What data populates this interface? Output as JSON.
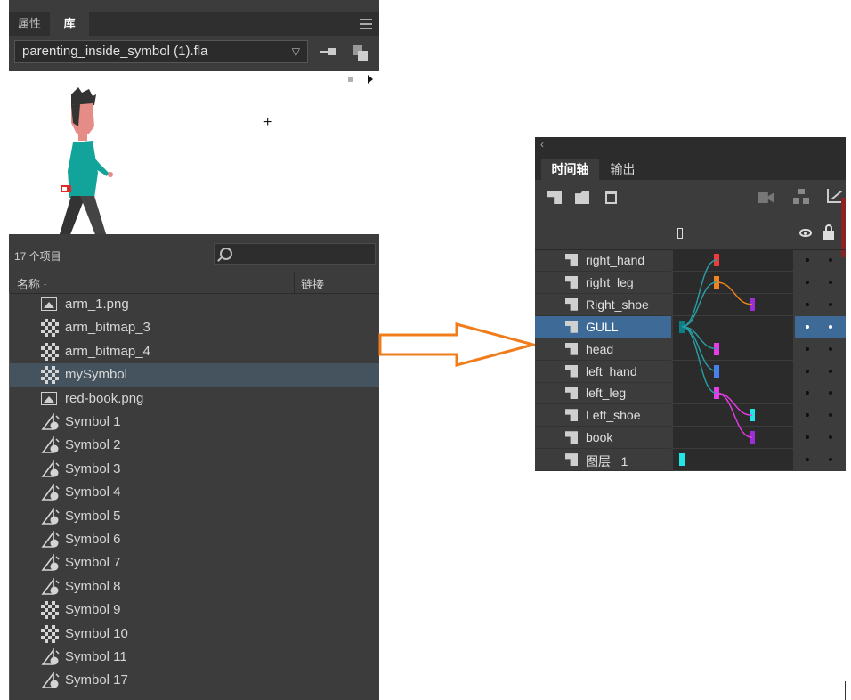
{
  "library": {
    "tabs": [
      "属性",
      "库"
    ],
    "document": "parenting_inside_symbol (1).fla",
    "item_count": "17 个项目",
    "columns": {
      "name": "名称",
      "sort_arrow": "↑",
      "linkage": "链接"
    },
    "items": [
      {
        "label": "arm_1.png",
        "icon": "bitmap-icon"
      },
      {
        "label": "arm_bitmap_3",
        "icon": "movieclip-icon"
      },
      {
        "label": "arm_bitmap_4",
        "icon": "movieclip-icon"
      },
      {
        "label": "mySymbol",
        "icon": "movieclip-icon",
        "selected": true
      },
      {
        "label": "red-book.png",
        "icon": "bitmap-icon"
      },
      {
        "label": "Symbol 1",
        "icon": "graphic-icon"
      },
      {
        "label": "Symbol 2",
        "icon": "graphic-icon"
      },
      {
        "label": "Symbol 3",
        "icon": "graphic-icon"
      },
      {
        "label": "Symbol 4",
        "icon": "graphic-icon"
      },
      {
        "label": "Symbol 5",
        "icon": "graphic-icon"
      },
      {
        "label": "Symbol 6",
        "icon": "graphic-icon"
      },
      {
        "label": "Symbol 7",
        "icon": "graphic-icon"
      },
      {
        "label": "Symbol 8",
        "icon": "graphic-icon"
      },
      {
        "label": "Symbol 9",
        "icon": "movieclip-icon"
      },
      {
        "label": "Symbol 10",
        "icon": "movieclip-icon"
      },
      {
        "label": "Symbol 11",
        "icon": "graphic-icon"
      },
      {
        "label": "Symbol 17",
        "icon": "graphic-icon"
      }
    ]
  },
  "timeline": {
    "tabs": [
      "时间轴",
      "输出"
    ],
    "layers": [
      {
        "name": "right_hand",
        "keyframe_color": "#ee3c3c",
        "frame_col": "a"
      },
      {
        "name": "right_leg",
        "keyframe_color": "#f0841e",
        "frame_col": "a"
      },
      {
        "name": "Right_shoe",
        "keyframe_color": "#9b2fd6",
        "frame_col": "b"
      },
      {
        "name": "GULL",
        "keyframe_color": "#0c7f86",
        "frame_col": "root",
        "selected": true
      },
      {
        "name": "head",
        "keyframe_color": "#e83ce8",
        "frame_col": "a"
      },
      {
        "name": "left_hand",
        "keyframe_color": "#4a7ff0",
        "frame_col": "a"
      },
      {
        "name": "left_leg",
        "keyframe_color": "#e83ce8",
        "frame_col": "a"
      },
      {
        "name": "Left_shoe",
        "keyframe_color": "#22e6e6",
        "frame_col": "b"
      },
      {
        "name": "book",
        "keyframe_color": "#9b2fd6",
        "frame_col": "b"
      },
      {
        "name": "图层 _1",
        "keyframe_color": "#22e6e6",
        "frame_col": "root"
      }
    ]
  },
  "colors": {
    "arrow": "#f07d1c",
    "selected_layer": "#3e6a98"
  }
}
